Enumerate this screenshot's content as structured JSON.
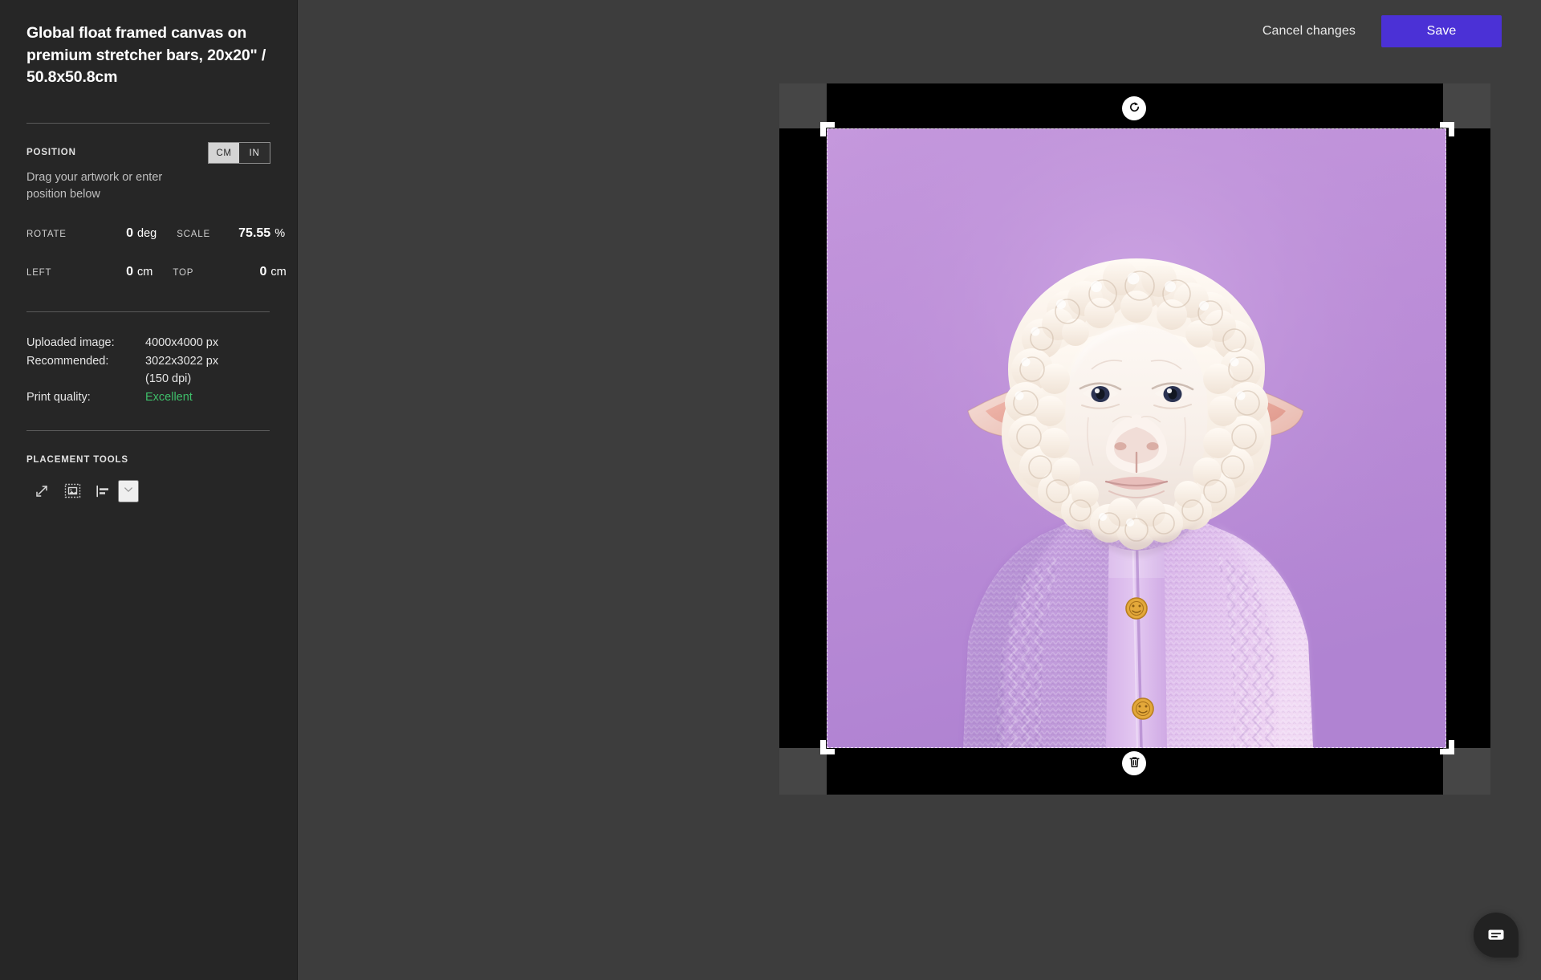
{
  "panel": {
    "title": "Global float framed canvas on premium stretcher bars, 20x20\" / 50.8x50.8cm",
    "position": {
      "label": "POSITION",
      "hint": "Drag your artwork or enter position below",
      "units": {
        "cm": "CM",
        "in": "IN",
        "selected": "IN"
      }
    },
    "fields": {
      "rotate_label": "ROTATE",
      "rotate_value": "0",
      "rotate_unit": "deg",
      "scale_label": "SCALE",
      "scale_value": "75.55",
      "scale_unit": "%",
      "left_label": "LEFT",
      "left_value": "0",
      "left_unit": "cm",
      "top_label": "TOP",
      "top_value": "0",
      "top_unit": "cm"
    },
    "info": {
      "uploaded_key": "Uploaded image:",
      "uploaded_value": "4000x4000 px",
      "recommended_key": "Recommended:",
      "recommended_value": "3022x3022 px",
      "recommended_value_2": "(150 dpi)",
      "quality_key": "Print quality:",
      "quality_value": "Excellent",
      "quality_color": "#3fbf6a"
    },
    "tools": {
      "label": "PLACEMENT TOOLS",
      "items": [
        {
          "name": "scale-to-fit-icon",
          "title": "Scale to fit"
        },
        {
          "name": "fit-image-to-frame-icon",
          "title": "Fit image in frame"
        },
        {
          "name": "align-left-icon",
          "title": "Align"
        },
        {
          "name": "chevron-down-icon",
          "title": "More alignment options"
        }
      ]
    }
  },
  "topbar": {
    "cancel_label": "Cancel changes",
    "save_label": "Save",
    "save_color": "#4b31d6"
  },
  "canvas": {
    "rotate_button": "rotate-artwork",
    "delete_button": "delete-artwork",
    "artwork_alt": "Sheep wearing a lilac knitted cardigan on a purple background",
    "background_color": "#3d3d3d",
    "frame_color": "#000000",
    "art_background": "#bf8fd8"
  },
  "chat": {
    "name": "chat-widget"
  }
}
